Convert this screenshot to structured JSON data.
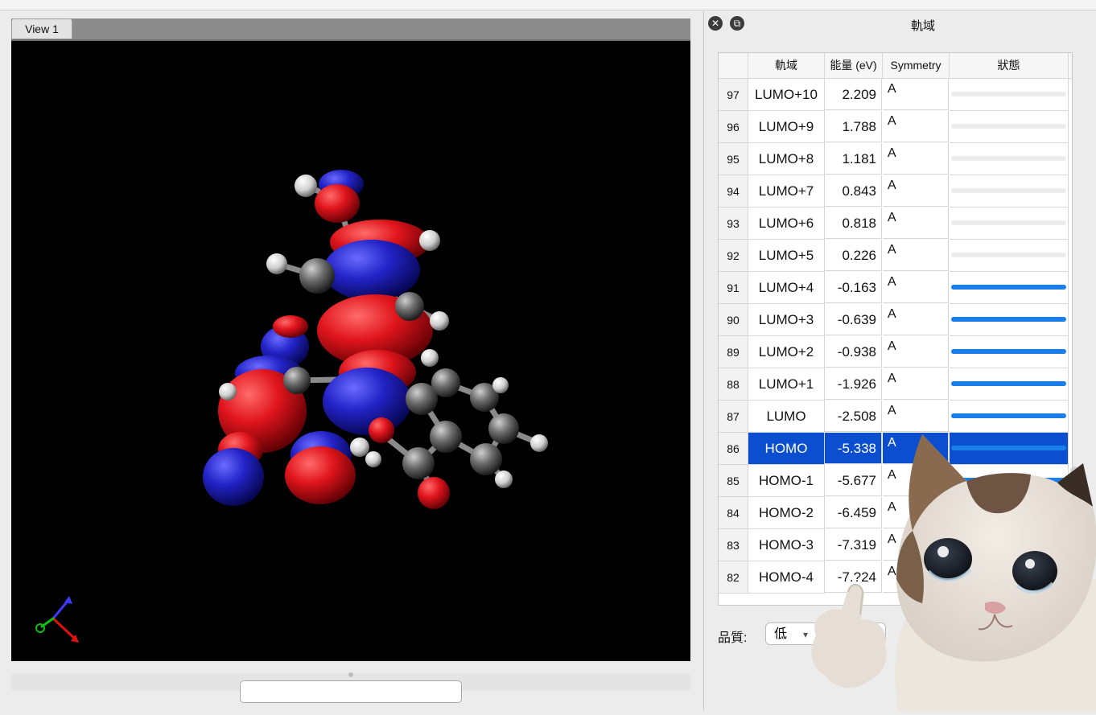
{
  "viewer": {
    "tab_label": "View 1"
  },
  "panel": {
    "title": "軌域",
    "close_icon": "close-icon",
    "restore_icon": "restore-window-icon",
    "columns": {
      "orbital": "軌域",
      "energy": "能量 (eV)",
      "symmetry": "Symmetry",
      "status": "狀態"
    },
    "rows": [
      {
        "num": "97",
        "orbital": "LUMO+10",
        "energy": "2.209",
        "symmetry": "A",
        "progress": 0
      },
      {
        "num": "96",
        "orbital": "LUMO+9",
        "energy": "1.788",
        "symmetry": "A",
        "progress": 0
      },
      {
        "num": "95",
        "orbital": "LUMO+8",
        "energy": "1.181",
        "symmetry": "A",
        "progress": 0
      },
      {
        "num": "94",
        "orbital": "LUMO+7",
        "energy": "0.843",
        "symmetry": "A",
        "progress": 0
      },
      {
        "num": "93",
        "orbital": "LUMO+6",
        "energy": "0.818",
        "symmetry": "A",
        "progress": 0
      },
      {
        "num": "92",
        "orbital": "LUMO+5",
        "energy": "0.226",
        "symmetry": "A",
        "progress": 0
      },
      {
        "num": "91",
        "orbital": "LUMO+4",
        "energy": "-0.163",
        "symmetry": "A",
        "progress": 1
      },
      {
        "num": "90",
        "orbital": "LUMO+3",
        "energy": "-0.639",
        "symmetry": "A",
        "progress": 1
      },
      {
        "num": "89",
        "orbital": "LUMO+2",
        "energy": "-0.938",
        "symmetry": "A",
        "progress": 1
      },
      {
        "num": "88",
        "orbital": "LUMO+1",
        "energy": "-1.926",
        "symmetry": "A",
        "progress": 1
      },
      {
        "num": "87",
        "orbital": "LUMO",
        "energy": "-2.508",
        "symmetry": "A",
        "progress": 1
      },
      {
        "num": "86",
        "orbital": "HOMO",
        "energy": "-5.338",
        "symmetry": "A",
        "progress": 1,
        "selected": true
      },
      {
        "num": "85",
        "orbital": "HOMO-1",
        "energy": "-5.677",
        "symmetry": "A",
        "progress": 1
      },
      {
        "num": "84",
        "orbital": "HOMO-2",
        "energy": "-6.459",
        "symmetry": "A",
        "progress": 1
      },
      {
        "num": "83",
        "orbital": "HOMO-3",
        "energy": "-7.319",
        "symmetry": "A",
        "progress": 1
      },
      {
        "num": "82",
        "orbital": "HOMO-4",
        "energy": "-7.?24",
        "symmetry": "A",
        "progress": 1
      }
    ],
    "quality": {
      "label": "品質:",
      "value": "低"
    }
  },
  "colors": {
    "selection": "#0b4fd0",
    "progress": "#1a7fe8",
    "orbital_positive": "#e0141c",
    "orbital_negative": "#2323c8"
  }
}
